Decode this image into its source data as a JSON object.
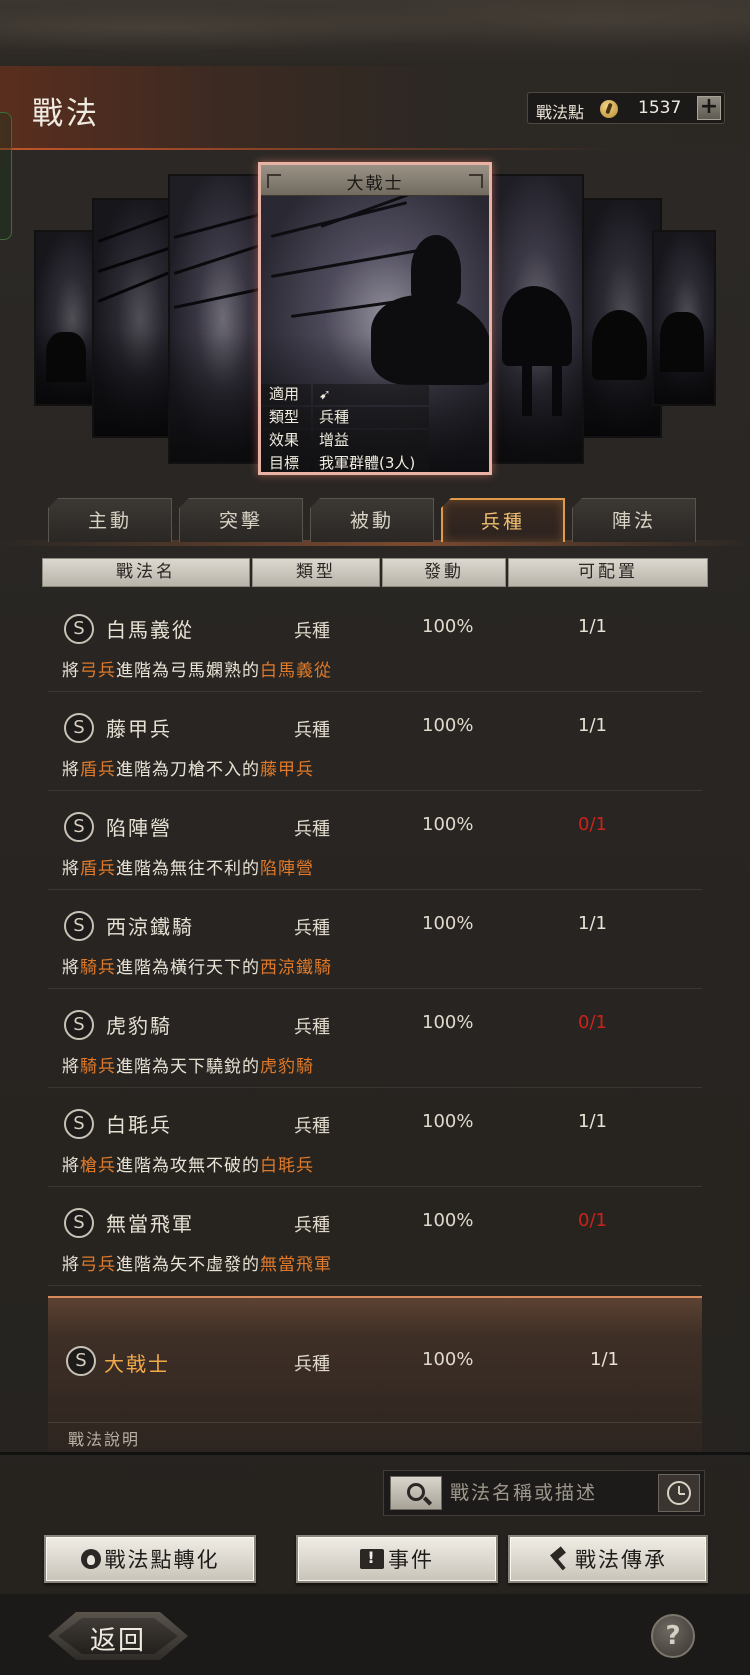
{
  "header": {
    "title": "戰法",
    "points_label": "戰法點",
    "points_value": "1537",
    "plus_label": "+"
  },
  "featured_card": {
    "name": "大戟士",
    "info": [
      {
        "key": "適用",
        "value": ""
      },
      {
        "key": "類型",
        "value": "兵種"
      },
      {
        "key": "效果",
        "value": "增益"
      },
      {
        "key": "目標",
        "value": "我軍群體(3人)"
      }
    ]
  },
  "tabs": [
    {
      "label": "主動"
    },
    {
      "label": "突擊"
    },
    {
      "label": "被動"
    },
    {
      "label": "兵種"
    },
    {
      "label": "陣法"
    }
  ],
  "active_tab": "兵種",
  "table": {
    "columns": [
      "戰法名",
      "類型",
      "發動",
      "可配置"
    ],
    "rows": [
      {
        "grade": "S",
        "name": "白馬義從",
        "type": "兵種",
        "rate": "100%",
        "slot": "1/1",
        "desc": [
          {
            "t": "將",
            "hl": false
          },
          {
            "t": "弓兵",
            "hl": true
          },
          {
            "t": "進階為弓馬嫻熟的",
            "hl": false
          },
          {
            "t": "白馬義從",
            "hl": true
          }
        ]
      },
      {
        "grade": "S",
        "name": "藤甲兵",
        "type": "兵種",
        "rate": "100%",
        "slot": "1/1",
        "desc": [
          {
            "t": "將",
            "hl": false
          },
          {
            "t": "盾兵",
            "hl": true
          },
          {
            "t": "進階為刀槍不入的",
            "hl": false
          },
          {
            "t": "藤甲兵",
            "hl": true
          }
        ]
      },
      {
        "grade": "S",
        "name": "陷陣營",
        "type": "兵種",
        "rate": "100%",
        "slot": "0/1",
        "desc": [
          {
            "t": "將",
            "hl": false
          },
          {
            "t": "盾兵",
            "hl": true
          },
          {
            "t": "進階為無往不利的",
            "hl": false
          },
          {
            "t": "陷陣營",
            "hl": true
          }
        ]
      },
      {
        "grade": "S",
        "name": "西涼鐵騎",
        "type": "兵種",
        "rate": "100%",
        "slot": "1/1",
        "desc": [
          {
            "t": "將",
            "hl": false
          },
          {
            "t": "騎兵",
            "hl": true
          },
          {
            "t": "進階為橫行天下的",
            "hl": false
          },
          {
            "t": "西涼鐵騎",
            "hl": true
          }
        ]
      },
      {
        "grade": "S",
        "name": "虎豹騎",
        "type": "兵種",
        "rate": "100%",
        "slot": "0/1",
        "desc": [
          {
            "t": "將",
            "hl": false
          },
          {
            "t": "騎兵",
            "hl": true
          },
          {
            "t": "進階為天下驍銳的",
            "hl": false
          },
          {
            "t": "虎豹騎",
            "hl": true
          }
        ]
      },
      {
        "grade": "S",
        "name": "白毦兵",
        "type": "兵種",
        "rate": "100%",
        "slot": "1/1",
        "desc": [
          {
            "t": "將",
            "hl": false
          },
          {
            "t": "槍兵",
            "hl": true
          },
          {
            "t": "進階為攻無不破的",
            "hl": false
          },
          {
            "t": "白毦兵",
            "hl": true
          }
        ]
      },
      {
        "grade": "S",
        "name": "無當飛軍",
        "type": "兵種",
        "rate": "100%",
        "slot": "0/1",
        "desc": [
          {
            "t": "將",
            "hl": false
          },
          {
            "t": "弓兵",
            "hl": true
          },
          {
            "t": "進階為矢不虛發的",
            "hl": false
          },
          {
            "t": "無當飛軍",
            "hl": true
          }
        ]
      }
    ],
    "selected": {
      "grade": "S",
      "name": "大戟士",
      "type": "兵種",
      "rate": "100%",
      "slot": "1/1",
      "sub_label": "戰法說明"
    }
  },
  "search": {
    "placeholder": "戰法名稱或描述"
  },
  "buttons": {
    "convert": "戰法點轉化",
    "events": "事件",
    "inherit": "戰法傳承"
  },
  "footer": {
    "back": "返回",
    "help": "?"
  },
  "colors": {
    "highlight": "#e07a2a",
    "zero_slot": "#c9241c",
    "active_tab": "#f0c070",
    "selected_name": "#f2a94a"
  }
}
